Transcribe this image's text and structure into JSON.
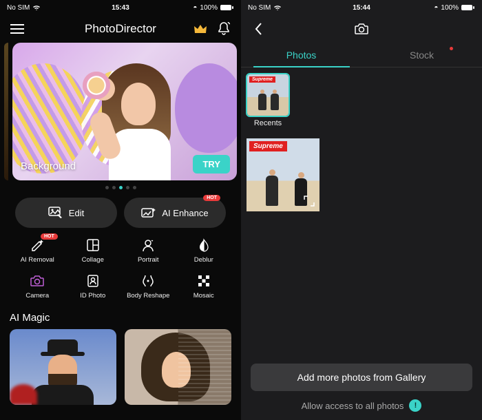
{
  "left": {
    "status": {
      "carrier": "No SIM",
      "time": "15:43",
      "battery": "100%"
    },
    "app_title": "PhotoDirector",
    "hero": {
      "label": "Background",
      "try_label": "TRY",
      "active_dot": 2,
      "dot_count": 5
    },
    "main_buttons": {
      "edit_label": "Edit",
      "enhance_label": "AI Enhance",
      "hot_label": "HOT"
    },
    "tools": [
      {
        "key": "removal",
        "label": "AI Removal",
        "hot": true
      },
      {
        "key": "collage",
        "label": "Collage",
        "hot": false
      },
      {
        "key": "portrait",
        "label": "Portrait",
        "hot": false
      },
      {
        "key": "deblur",
        "label": "Deblur",
        "hot": false
      },
      {
        "key": "camera",
        "label": "Camera",
        "hot": false
      },
      {
        "key": "idphoto",
        "label": "ID Photo",
        "hot": false
      },
      {
        "key": "reshape",
        "label": "Body Reshape",
        "hot": false
      },
      {
        "key": "mosaic",
        "label": "Mosaic",
        "hot": false
      }
    ],
    "section_title": "AI Magic"
  },
  "right": {
    "status": {
      "carrier": "No SIM",
      "time": "15:44",
      "battery": "100%"
    },
    "tabs": {
      "photos": "Photos",
      "stock": "Stock",
      "active": "photos"
    },
    "albums": [
      {
        "label": "Recents",
        "badge": "Supreme",
        "active": true
      }
    ],
    "photos": [
      {
        "badge": "Supreme"
      }
    ],
    "add_label": "Add more photos from Gallery",
    "allow_label": "Allow access to all photos",
    "allow_badge": "!"
  }
}
